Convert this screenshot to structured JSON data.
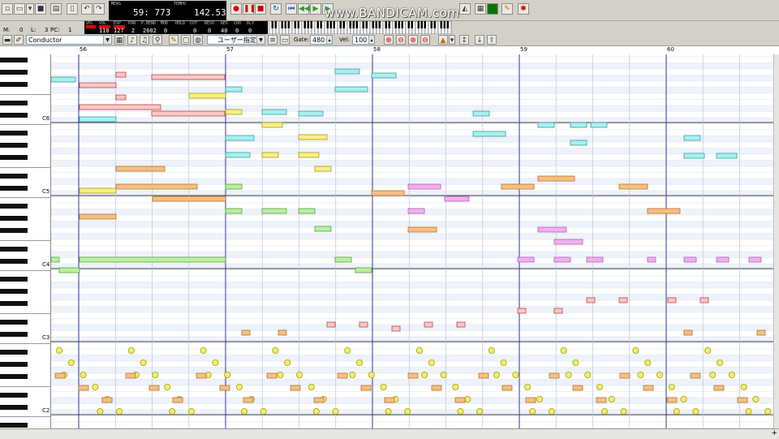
{
  "toolbar": {
    "meas_label": "MEAS",
    "position": "59: 773",
    "tempo_label": "TEMPO",
    "tempo": "142.53",
    "watermark": "www.BANDICAM.com"
  },
  "mixer": {
    "labels": [
      "VEL",
      "VOL",
      "EXP",
      "PAN",
      "P.BEND",
      "MOD",
      "HOLD",
      "CUT",
      "RESO",
      "REV",
      "CHO",
      "DLY"
    ],
    "values": [
      "",
      "110",
      "127",
      "2",
      "2602",
      "0",
      "",
      "0",
      "0",
      "40",
      "0",
      "0"
    ]
  },
  "port_row": {
    "m_label": "M:",
    "m_value": "0",
    "l_label": "L:",
    "l_value": "3",
    "pc_label": "PC:",
    "pc_value": "1"
  },
  "track_combo": {
    "value": "Conductor"
  },
  "user_combo": {
    "value": "ユーザー指定..."
  },
  "gate": {
    "label": "Gate:",
    "value": "480"
  },
  "vel": {
    "label": "Vel:",
    "value": "100"
  },
  "measures": [
    "56",
    "57",
    "58",
    "59",
    "60"
  ],
  "octave_labels": [
    "C6",
    "C5",
    "C4",
    "C3",
    "C2"
  ],
  "colors": {
    "cyan": "#a8f0f0",
    "pink_outline": "#f0a0a0",
    "orange": "#f8c080",
    "yellow": "#f8f080",
    "green": "#b8f0a0",
    "magenta": "#f0b0f0",
    "beat": "#0000a0"
  }
}
